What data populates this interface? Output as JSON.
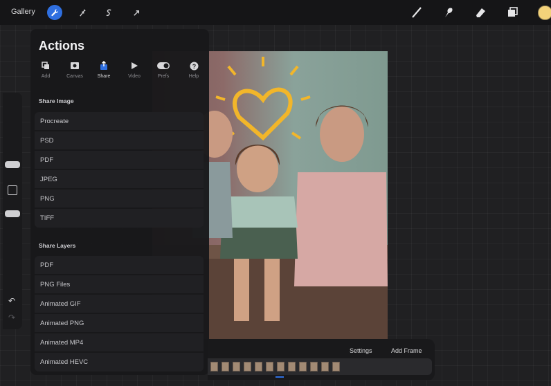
{
  "topbar": {
    "gallery_label": "Gallery"
  },
  "colors": {
    "accent": "#2f6fe0",
    "current_color": "#f3d27a",
    "panel_bg": "#18181a"
  },
  "actions": {
    "title": "Actions",
    "tabs": [
      {
        "label": "Add",
        "icon": "add-icon"
      },
      {
        "label": "Canvas",
        "icon": "canvas-icon"
      },
      {
        "label": "Share",
        "icon": "share-icon"
      },
      {
        "label": "Video",
        "icon": "video-icon"
      },
      {
        "label": "Prefs",
        "icon": "prefs-icon"
      },
      {
        "label": "Help",
        "icon": "help-icon"
      }
    ],
    "active_tab": "Share",
    "share_image": {
      "title": "Share Image",
      "items": [
        "Procreate",
        "PSD",
        "PDF",
        "JPEG",
        "PNG",
        "TIFF"
      ]
    },
    "share_layers": {
      "title": "Share Layers",
      "items": [
        "PDF",
        "PNG Files",
        "Animated GIF",
        "Animated PNG",
        "Animated MP4",
        "Animated HEVC"
      ]
    }
  },
  "animation": {
    "settings_label": "Settings",
    "add_frame_label": "Add Frame"
  }
}
